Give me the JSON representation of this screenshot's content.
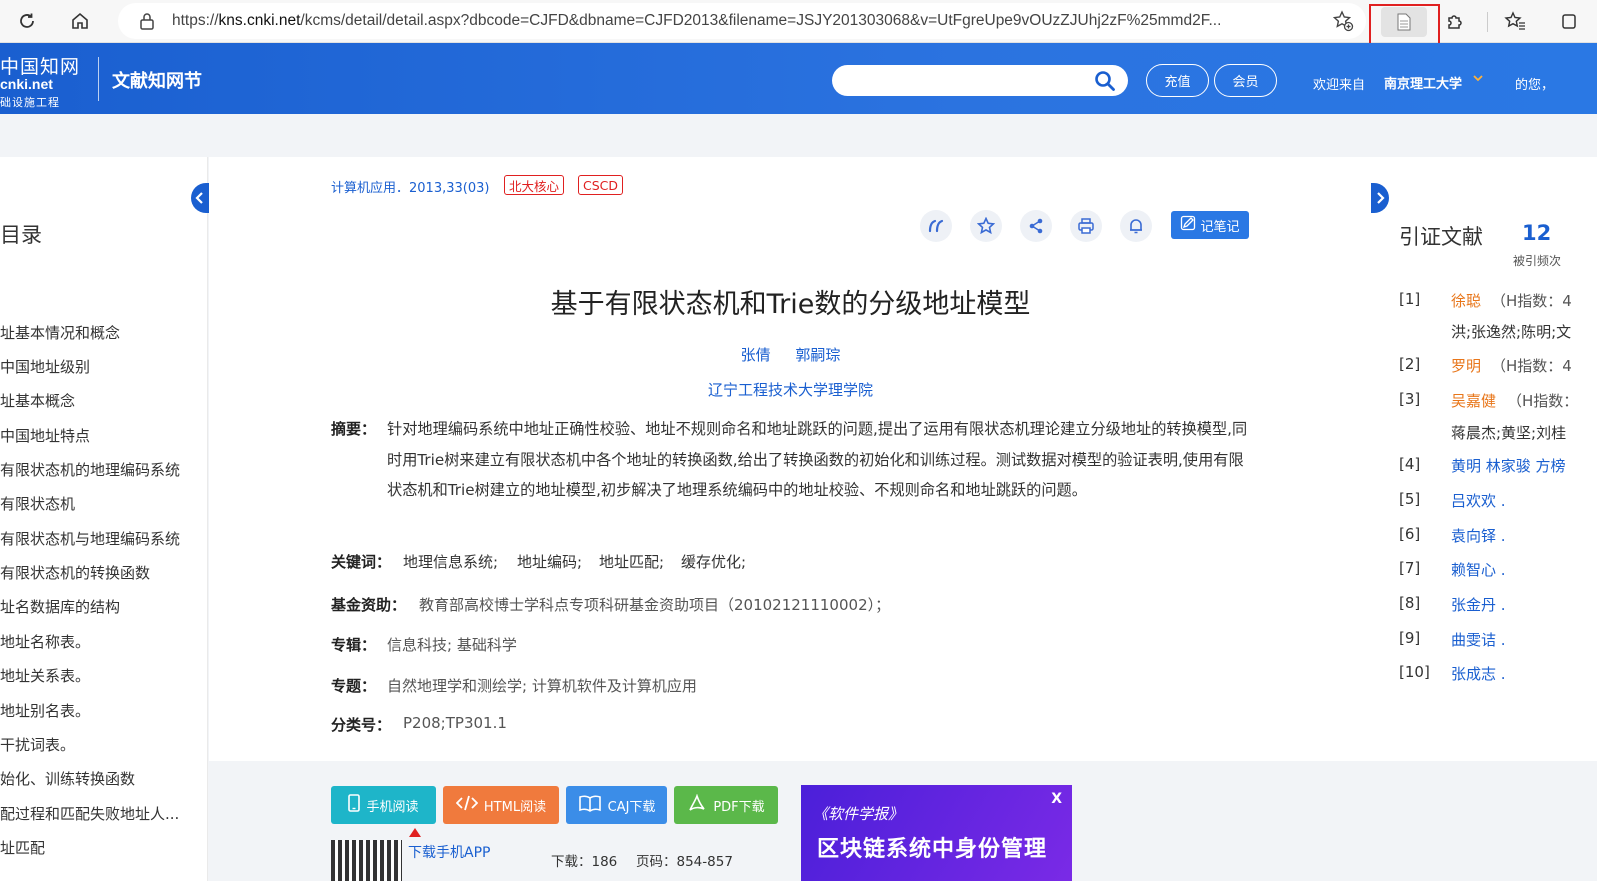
{
  "browser": {
    "url_prefix": "https://",
    "url_host": "kns.cnki.net",
    "url_rest": "/kcms/detail/detail.aspx?dbcode=CJFD&dbname=CJFD2013&filename=JSJY201303068&v=UtFgreUpe9vOUzZJUhj2zF%25mmd2F..."
  },
  "header": {
    "logo_zh": "中国知网",
    "logo_en": "cnki.net",
    "logo_sub": "础设施工程",
    "site_name": "文献知网节",
    "recharge_label": "充值",
    "member_label": "会员",
    "welcome": "欢迎来自",
    "institution": "南京理工大学",
    "mine": "的您，"
  },
  "toc": {
    "title": "目录",
    "items": [
      "址基本情况和概念",
      "中国地址级别",
      "址基本概念",
      "中国地址特点",
      "有限状态机的地理编码系统",
      "有限状态机",
      "有限状态机与地理编码系统",
      "有限状态机的转换函数",
      "址名数据库的结构",
      "地址名称表。",
      "地址关系表。",
      "地址别名表。",
      "干扰词表。",
      "始化、训练转换函数",
      "配过程和匹配失败地址人...",
      "址匹配"
    ]
  },
  "article": {
    "journal": "计算机应用．2013,33(03)",
    "badges": [
      "北大核心",
      "CSCD"
    ],
    "note_label": "记笔记",
    "title": "基于有限状态机和Trie数的分级地址模型",
    "authors": [
      "张倩",
      "郭嗣琮"
    ],
    "affiliation": "辽宁工程技术大学理学院",
    "abstract_label": "摘要：",
    "abstract": "针对地理编码系统中地址正确性校验、地址不规则命名和地址跳跃的问题,提出了运用有限状态机理论建立分级地址的转换模型,同时用Trie树来建立有限状态机中各个地址的转换函数,给出了转换函数的初始化和训练过程。测试数据对模型的验证表明,使用有限状态机和Trie树建立的地址模型,初步解决了地理系统编码中的地址校验、不规则命名和地址跳跃的问题。",
    "keywords_label": "关键词：",
    "keywords": [
      "地理信息系统;",
      "地址编码;",
      "地址匹配;",
      "缓存优化;"
    ],
    "fund_label": "基金资助：",
    "fund": "教育部高校博士学科点专项科研基金资助项目（20102121110002）；",
    "series_label": "专辑：",
    "series": "信息科技; 基础科学",
    "topic_label": "专题：",
    "topic": "自然地理学和测绘学; 计算机软件及计算机应用",
    "class_label": "分类号：",
    "class_no": "P208;TP301.1"
  },
  "downloads": {
    "mobile": "手机阅读",
    "html": "HTML阅读",
    "caj": "CAJ下载",
    "pdf": "PDF下载",
    "app": "下载手机APP",
    "downloads_label": "下载：",
    "downloads_count": "186",
    "pages_label": "页码：",
    "pages": "854-857"
  },
  "ad": {
    "journal": "《软件学报》",
    "headline": "区块链系统中身份管理",
    "close": "X"
  },
  "citations": {
    "title": "引证文献",
    "count": "12",
    "sub": "被引频次",
    "refs": [
      {
        "num": "[1]",
        "name": "徐聪",
        "extra": "（H指数：4",
        "line2": "洪;张逸然;陈明;文"
      },
      {
        "num": "[2]",
        "name": "罗明",
        "extra": "（H指数：4",
        "line2": ""
      },
      {
        "num": "[3]",
        "name": "吴嘉健",
        "extra": "（H指数：",
        "line2": "蒋晨杰;黄坚;刘桂"
      },
      {
        "num": "[4]",
        "name": "黄明 林家骏 方榜",
        "extra": "",
        "line2": ""
      },
      {
        "num": "[5]",
        "name": "吕欢欢 .",
        "extra": "",
        "line2": ""
      },
      {
        "num": "[6]",
        "name": "袁向铎 .",
        "extra": "",
        "line2": ""
      },
      {
        "num": "[7]",
        "name": "赖智心 .",
        "extra": "",
        "line2": ""
      },
      {
        "num": "[8]",
        "name": "张金丹 .",
        "extra": "",
        "line2": ""
      },
      {
        "num": "[9]",
        "name": "曲雯诘 .",
        "extra": "",
        "line2": ""
      },
      {
        "num": "[10]",
        "name": "张成志 .",
        "extra": "",
        "line2": ""
      }
    ]
  },
  "colors": {
    "brand_blue": "#1a5fd0",
    "highlight_red": "#e02020",
    "author_orange": "#e8761a"
  }
}
